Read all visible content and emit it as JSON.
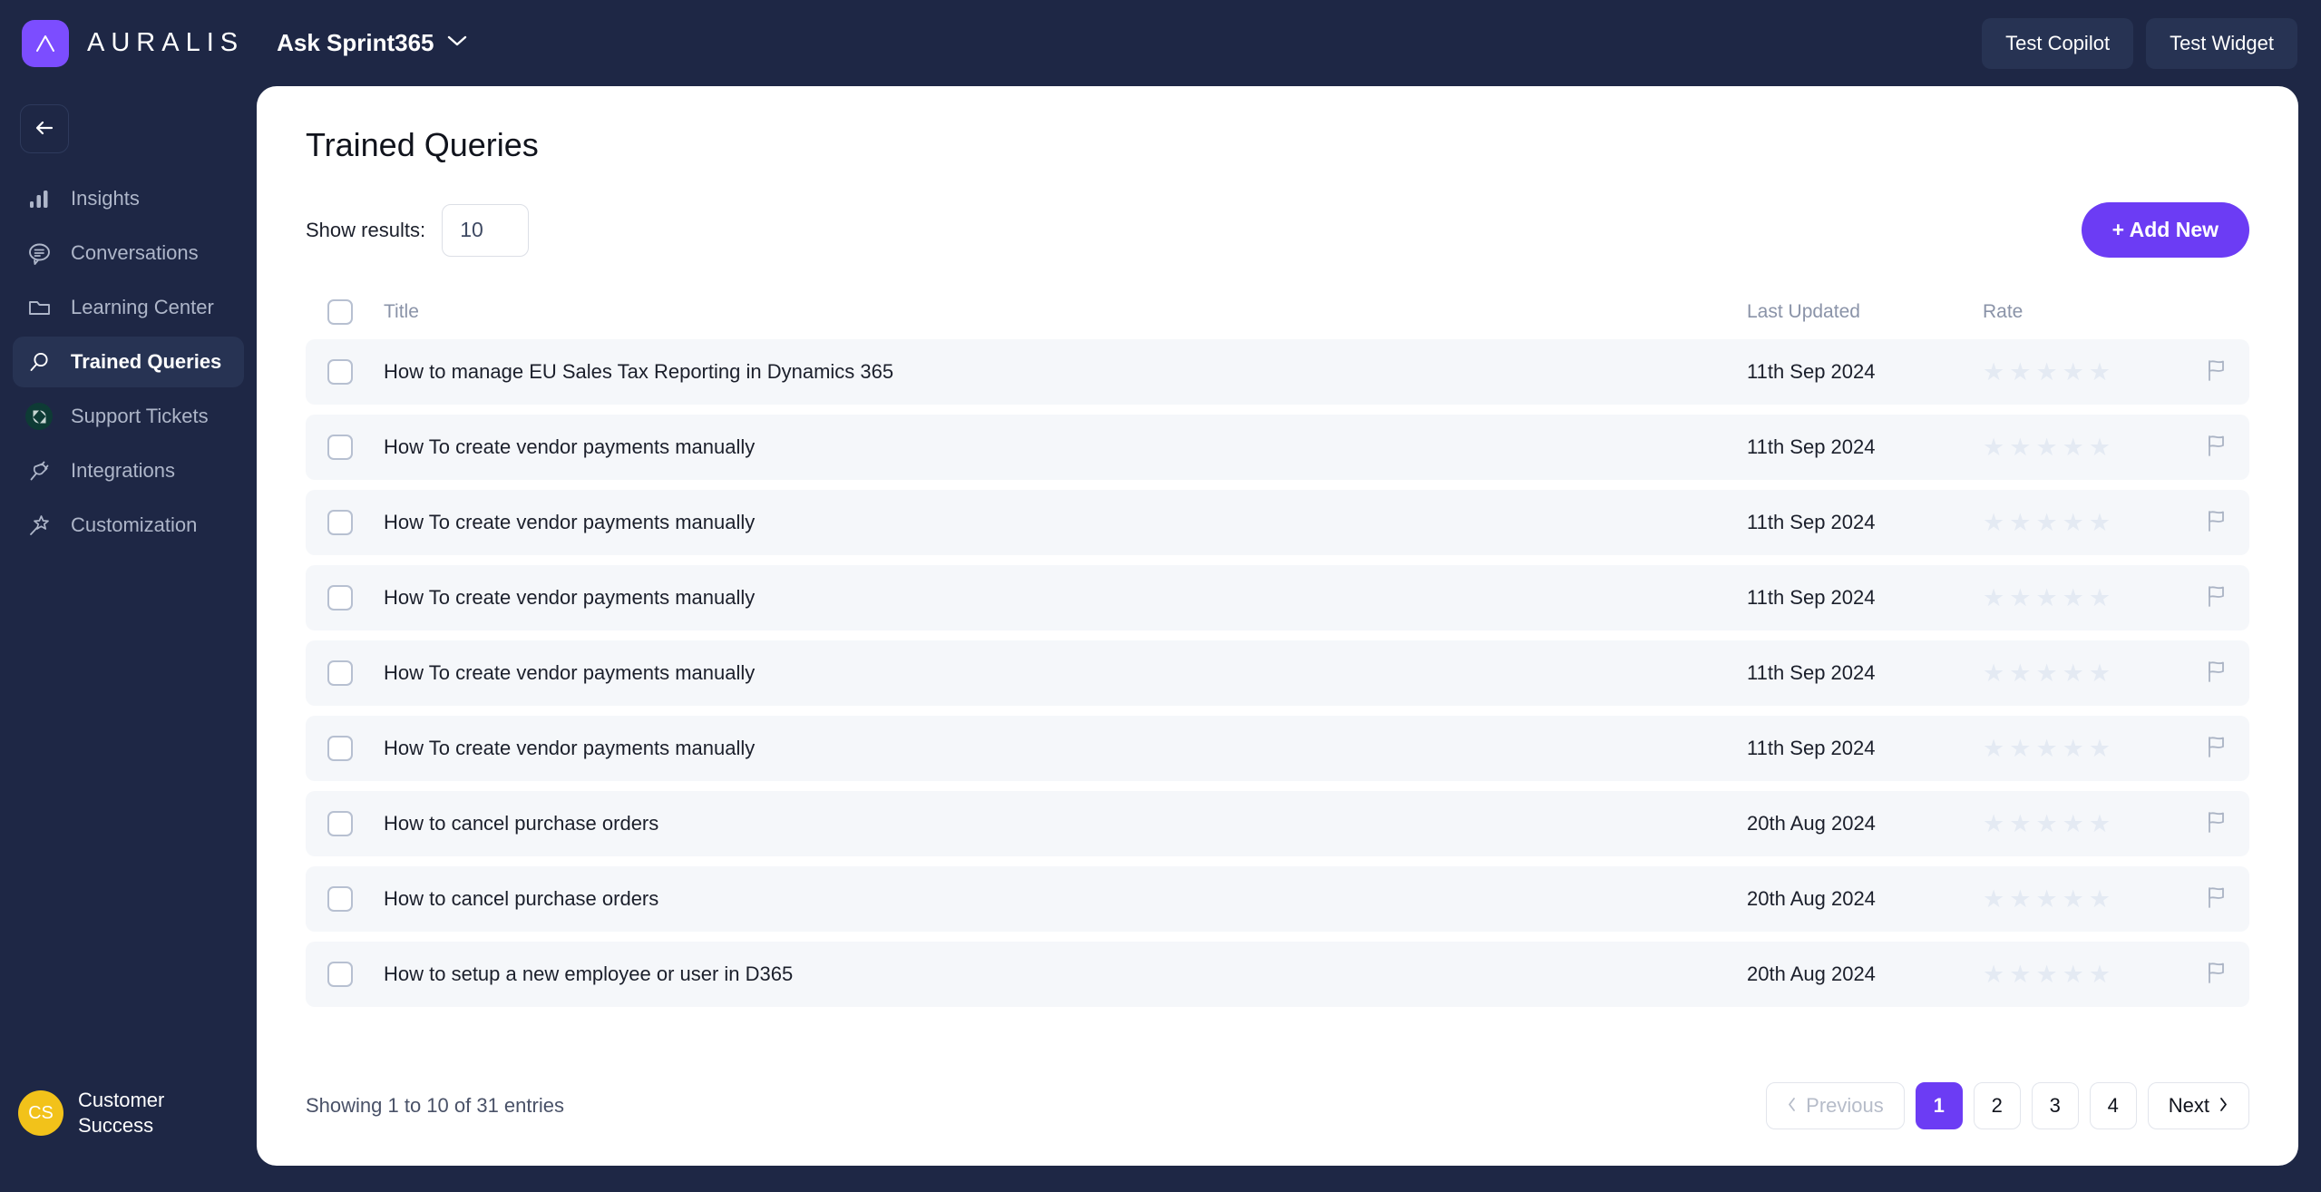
{
  "brand": {
    "name": "AURALIS",
    "logo_icon": "auralis-chevron-logo"
  },
  "topbar": {
    "workspace": "Ask Sprint365",
    "workspace_chevron_icon": "chevron-down-icon",
    "test_copilot_label": "Test Copilot",
    "test_widget_label": "Test Widget"
  },
  "sidebar": {
    "back_icon": "arrow-left-icon",
    "items": [
      {
        "label": "Insights",
        "icon": "bar-chart-icon",
        "active": false
      },
      {
        "label": "Conversations",
        "icon": "chat-bubble-icon",
        "active": false
      },
      {
        "label": "Learning Center",
        "icon": "folder-icon",
        "active": false
      },
      {
        "label": "Trained Queries",
        "icon": "search-icon",
        "active": true
      },
      {
        "label": "Support Tickets",
        "icon": "zendesk-icon",
        "active": false
      },
      {
        "label": "Integrations",
        "icon": "plug-icon",
        "active": false
      },
      {
        "label": "Customization",
        "icon": "magic-wand-star-icon",
        "active": false
      }
    ],
    "user": {
      "initials": "CS",
      "name_line1": "Customer",
      "name_line2": "Success"
    }
  },
  "main": {
    "title": "Trained Queries",
    "show_results_label": "Show results:",
    "show_results_value": "10",
    "show_results_chevron_icon": "chevron-down-icon",
    "add_new_label": "+ Add New",
    "table": {
      "headers": {
        "title": "Title",
        "last_updated": "Last Updated",
        "rate": "Rate"
      },
      "rows": [
        {
          "title": "How to manage EU Sales Tax Reporting in Dynamics 365",
          "last_updated": "11th Sep 2024",
          "rating": 0,
          "flag_icon": "flag-icon"
        },
        {
          "title": "How To create vendor payments manually",
          "last_updated": "11th Sep 2024",
          "rating": 0,
          "flag_icon": "flag-icon"
        },
        {
          "title": "How To create vendor payments manually",
          "last_updated": "11th Sep 2024",
          "rating": 0,
          "flag_icon": "flag-icon"
        },
        {
          "title": "How To create vendor payments manually",
          "last_updated": "11th Sep 2024",
          "rating": 0,
          "flag_icon": "flag-icon"
        },
        {
          "title": "How To create vendor payments manually",
          "last_updated": "11th Sep 2024",
          "rating": 0,
          "flag_icon": "flag-icon"
        },
        {
          "title": "How To create vendor payments manually",
          "last_updated": "11th Sep 2024",
          "rating": 0,
          "flag_icon": "flag-icon"
        },
        {
          "title": "How to cancel purchase orders",
          "last_updated": "20th Aug 2024",
          "rating": 0,
          "flag_icon": "flag-icon"
        },
        {
          "title": "How to cancel purchase orders",
          "last_updated": "20th Aug 2024",
          "rating": 0,
          "flag_icon": "flag-icon"
        },
        {
          "title": "How to setup a new employee or user in D365",
          "last_updated": "20th Aug 2024",
          "rating": 0,
          "flag_icon": "flag-icon"
        }
      ]
    },
    "footer": {
      "entries_text": "Showing 1 to 10 of 31 entries",
      "previous_label": "Previous",
      "next_label": "Next",
      "pages": [
        "1",
        "2",
        "3",
        "4"
      ],
      "active_page": "1"
    }
  },
  "colors": {
    "navy": "#1e2745",
    "navy_surface": "#273353",
    "accent_purple": "#6c3cf4",
    "logo_purple": "#7c4dff",
    "avatar_yellow": "#f2c21a",
    "zendesk_green": "#0e3b35",
    "row_bg": "#f5f7fa",
    "star_empty": "#e4eaf3"
  }
}
